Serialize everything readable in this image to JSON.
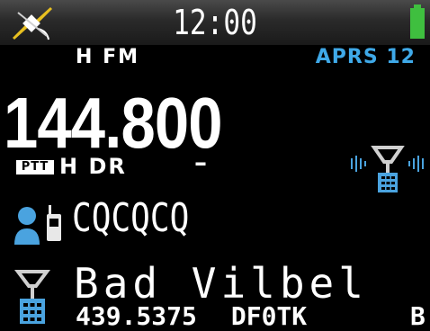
{
  "status": {
    "time": "12:00"
  },
  "header": {
    "mode": "H FM",
    "aprs": "APRS 12"
  },
  "frequency": "144.800",
  "sub": {
    "ptt": "PTT",
    "mode": "H DR",
    "dash": "–"
  },
  "callsign": "CQCQCQ",
  "repeater": {
    "name": "Bad Vilbel",
    "frequency": "439.5375",
    "callsign": "DF0TK",
    "band": "B"
  },
  "colors": {
    "aprs": "#3fa9e8",
    "icon_blue": "#4aa3df",
    "battery": "#3fbf3f",
    "gps": "#e8c020"
  },
  "icons": [
    "gps-satellite-icon",
    "battery-icon",
    "repeater-signal-icon",
    "callsign-icon",
    "repeater-tower-icon"
  ]
}
